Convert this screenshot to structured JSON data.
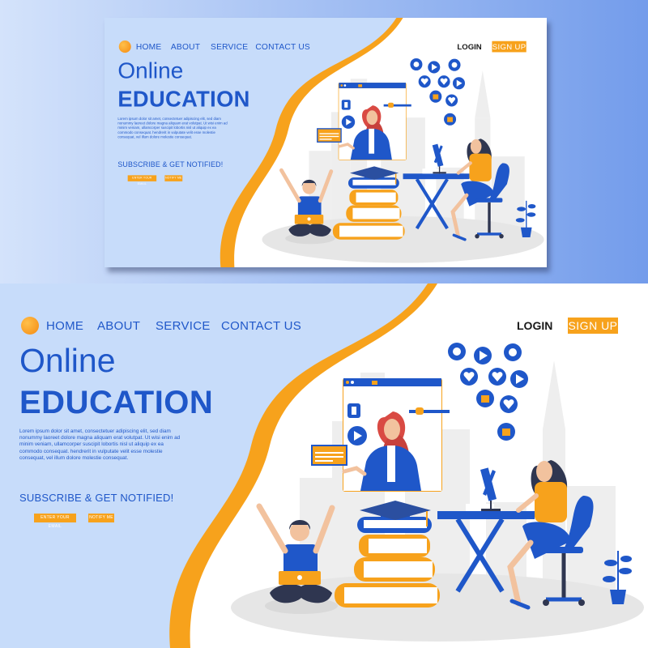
{
  "nav": {
    "home": "HOME",
    "about": "ABOUT",
    "service": "SERVICE",
    "contact": "CONTACT US"
  },
  "auth": {
    "login": "LOGIN",
    "signup": "SIGN UP"
  },
  "hero": {
    "title_line1": "Online",
    "title_line2": "EDUCATION",
    "body": "Lorem ipsum dolor sit amet, consectetuer adipiscing elit, sed diam nonummy laoreet dolore magna aliquam erat volutpat. Ut wisi enim ad minim veniam, ullamcorper suscipit lobortis nisl ut aliquip ex ea commodo consequat. hendrerit in vulputate velit esse molestie consequat, vel illum dolore molestie consequat.",
    "subscribe": "SUBSCRIBE & GET NOTIFIED!",
    "email_button": "ENTER YOUR EMAIL",
    "notify_button": "NOTIFY ME"
  },
  "colors": {
    "primary": "#1f57c9",
    "accent": "#f7a21c",
    "left_panel": "#c7dcfa",
    "background": "#7fa4ee"
  },
  "icons": [
    "gear-icon",
    "play-icon",
    "heart-icon",
    "like-icon",
    "image-icon",
    "phone-icon"
  ]
}
